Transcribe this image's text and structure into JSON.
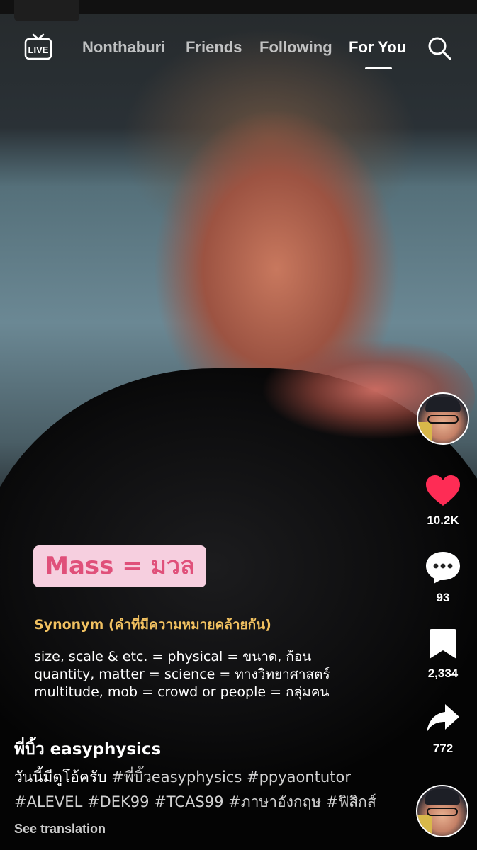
{
  "nav": {
    "live_label": "LIVE",
    "tabs": [
      "Nonthaburi",
      "Friends",
      "Following",
      "For You"
    ],
    "active_tab": "For You"
  },
  "actions": {
    "likes": "10.2K",
    "comments": "93",
    "saves": "2,334",
    "shares": "772",
    "like_color": "#fe2c55"
  },
  "overlay": {
    "title": "Mass = มวล",
    "synonym_heading": "Synonym (คำที่มีความหมายคล้ายกัน)",
    "lines": [
      "size, scale & etc. = physical = ขนาด, ก้อน",
      "quantity, matter = science = ทางวิทยาศาสตร์",
      "multitude, mob = crowd or people = กลุ่มคน"
    ]
  },
  "post": {
    "author": "พี่บิ้ว easyphysics",
    "caption_text": "วันนี้มีดูโอ้ครับ",
    "hashtags_line1": [
      "#พี่บิ้วeasyphysics",
      "#ppyaontutor"
    ],
    "hashtags_line2": [
      "#ALEVEL",
      "#DEK99",
      "#TCAS99",
      "#ภาษาอังกฤษ",
      "#ฟิสิกส์"
    ],
    "see_translation": "See translation"
  }
}
